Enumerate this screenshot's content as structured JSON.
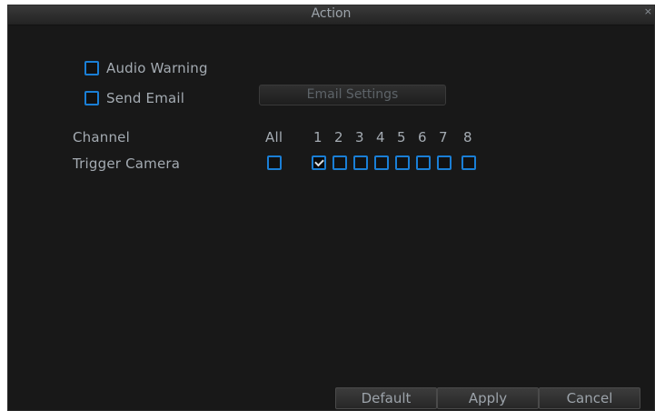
{
  "window": {
    "title": "Action",
    "close_glyph": "×"
  },
  "options": {
    "audio_warning": {
      "label": "Audio Warning",
      "checked": false
    },
    "send_email": {
      "label": "Send Email",
      "checked": false
    },
    "email_settings_label": "Email Settings"
  },
  "channel_row": {
    "label": "Channel",
    "all_label": "All",
    "channels": [
      "1",
      "2",
      "3",
      "4",
      "5",
      "6",
      "7",
      "8"
    ]
  },
  "trigger_row": {
    "label": "Trigger Camera",
    "all_checked": false,
    "checked": [
      true,
      false,
      false,
      false,
      false,
      false,
      false,
      false
    ]
  },
  "footer": {
    "default_label": "Default",
    "apply_label": "Apply",
    "cancel_label": "Cancel"
  },
  "colors": {
    "accent": "#1a7fd6",
    "background": "#181818",
    "text": "#a4abb2"
  }
}
